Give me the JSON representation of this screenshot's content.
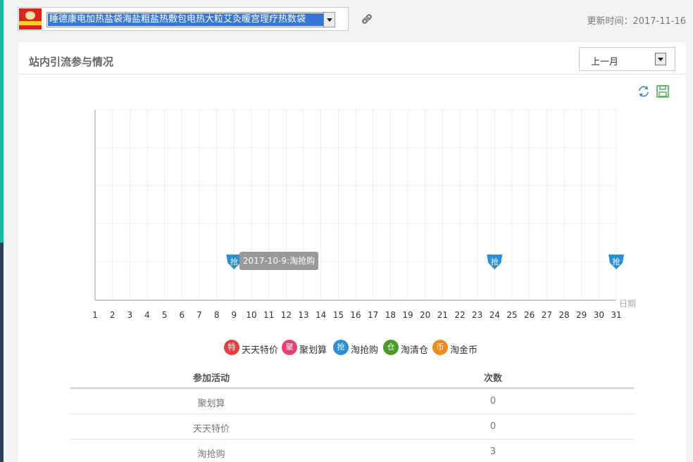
{
  "header": {
    "product_title": "睡德康电加热盐袋海盐粗盐热敷包电热大粒艾灸暖宫理疗热数袋",
    "update_label": "更新时间：2017-11-16",
    "product_image": "product-thumbnail",
    "link_icon": "link-icon"
  },
  "panel": {
    "title": "站内引流参与情况",
    "period": "上一月",
    "refresh_icon": "refresh-icon",
    "save_icon": "save-icon"
  },
  "chart_data": {
    "type": "scatter",
    "xlabel": "日期",
    "x_ticks": [
      "1",
      "2",
      "3",
      "4",
      "5",
      "6",
      "7",
      "8",
      "9",
      "10",
      "11",
      "12",
      "13",
      "14",
      "15",
      "16",
      "17",
      "18",
      "19",
      "20",
      "21",
      "22",
      "23",
      "24",
      "25",
      "26",
      "27",
      "28",
      "29",
      "30",
      "31"
    ],
    "xlim": [
      1,
      31
    ],
    "grid": true,
    "legend_position": "bottom",
    "series": [
      {
        "name": "天天特价",
        "badge": "特",
        "color": "#e0413e",
        "points": []
      },
      {
        "name": "聚划算",
        "badge": "聚",
        "color": "#e5406f",
        "points": []
      },
      {
        "name": "淘抢购",
        "badge": "抢",
        "color": "#2d8fd0",
        "points": [
          9,
          24,
          31
        ]
      },
      {
        "name": "淘清仓",
        "badge": "仓",
        "color": "#4d9a2b",
        "points": []
      },
      {
        "name": "淘金币",
        "badge": "币",
        "color": "#f08a1d",
        "points": []
      }
    ],
    "tooltip": "2017-10-9:淘抢购"
  },
  "table": {
    "headers": [
      "参加活动",
      "次数"
    ],
    "rows": [
      {
        "name": "聚划算",
        "count": "0"
      },
      {
        "name": "天天特价",
        "count": "0"
      },
      {
        "name": "淘抢购",
        "count": "3"
      }
    ]
  }
}
